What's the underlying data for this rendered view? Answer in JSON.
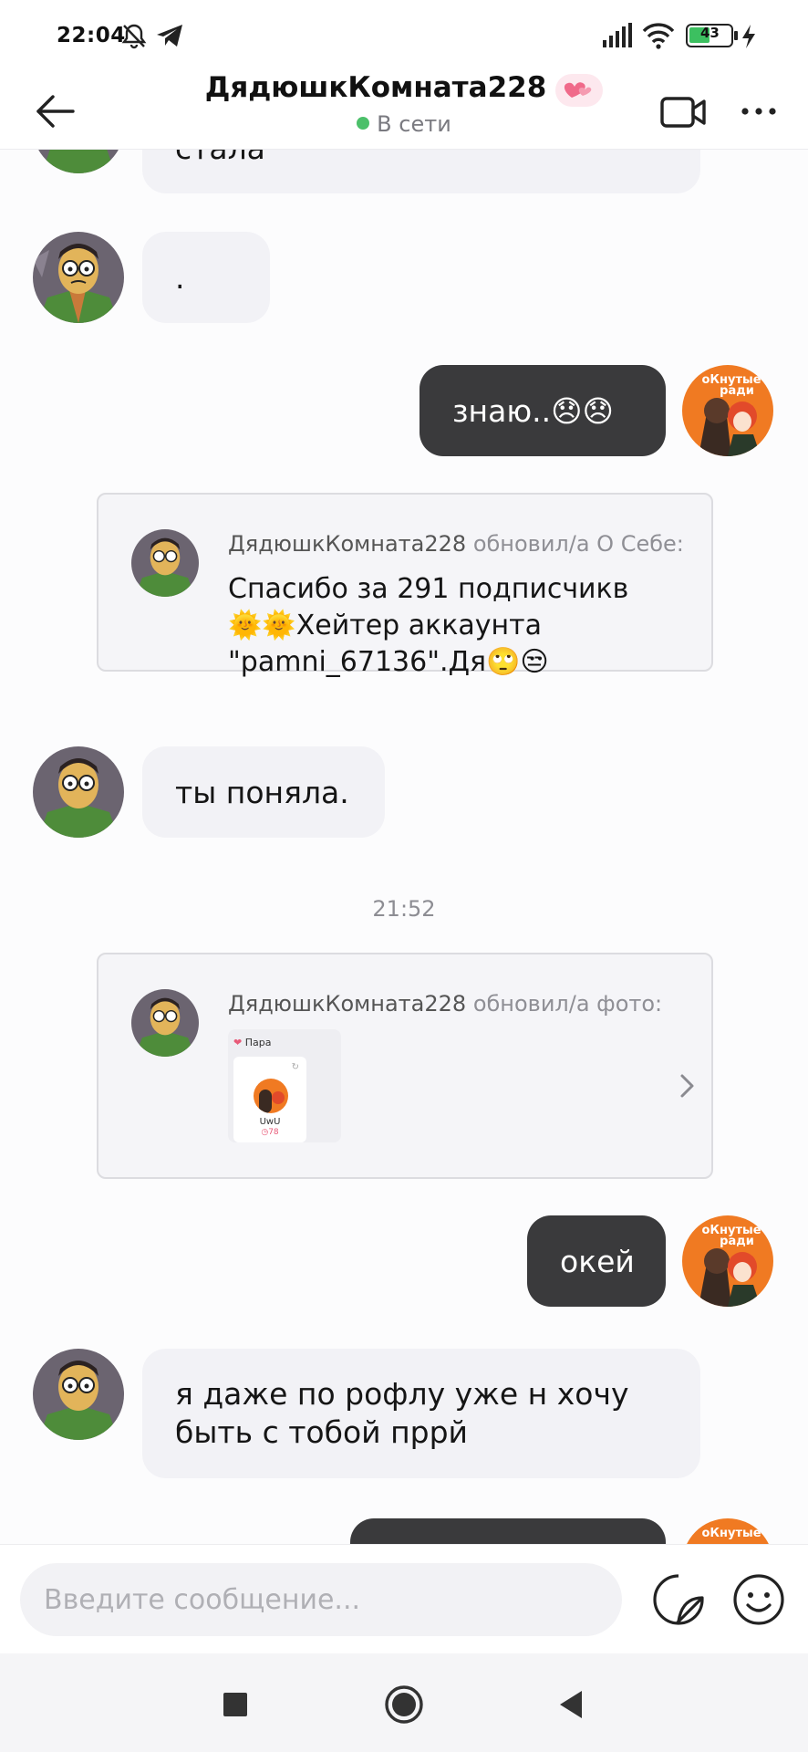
{
  "status_bar": {
    "time": "22:04",
    "battery": "43"
  },
  "header": {
    "title": "ДядюшкКомната228",
    "status": "В сети"
  },
  "messages": {
    "m0_text": "стала",
    "m1_text": ".",
    "m2_text": "знаю..😞😞",
    "card1": {
      "author": "ДядюшкКомната228",
      "action": "обновил/а О Себе:",
      "line1": "Спасибо за 291 подписчикв",
      "line2": "🌞🌞Хейтер аккаунта",
      "line3": "\"pamni_67136\".Дя🙄😒"
    },
    "m3_text": "ты поняла.",
    "timestamp": "21:52",
    "card2": {
      "author": "ДядюшкКомната228",
      "action": "обновил/а фото:",
      "thumb_label": "Пара",
      "thumb_name": "UwU",
      "thumb_count": "78"
    },
    "m4_text": "окей",
    "m5_line1": "я даже по рофлу уже н хочу",
    "m5_line2": "быть с тобой пррй",
    "other_avatar_text": "оКнутые\nради"
  },
  "input": {
    "placeholder": "Введите сообщение..."
  },
  "colors": {
    "outgoing_bubble": "#3a3a3c",
    "incoming_bubble": "#f2f2f6",
    "online": "#4cc06a",
    "brand_pink": "#e85a78"
  },
  "icons": {
    "back": "arrow-left-icon",
    "video": "video-camera-icon",
    "more": "more-dots-icon",
    "sticker": "sticker-icon",
    "emoji": "smiley-icon",
    "card_chevron": "chevron-right-icon"
  }
}
